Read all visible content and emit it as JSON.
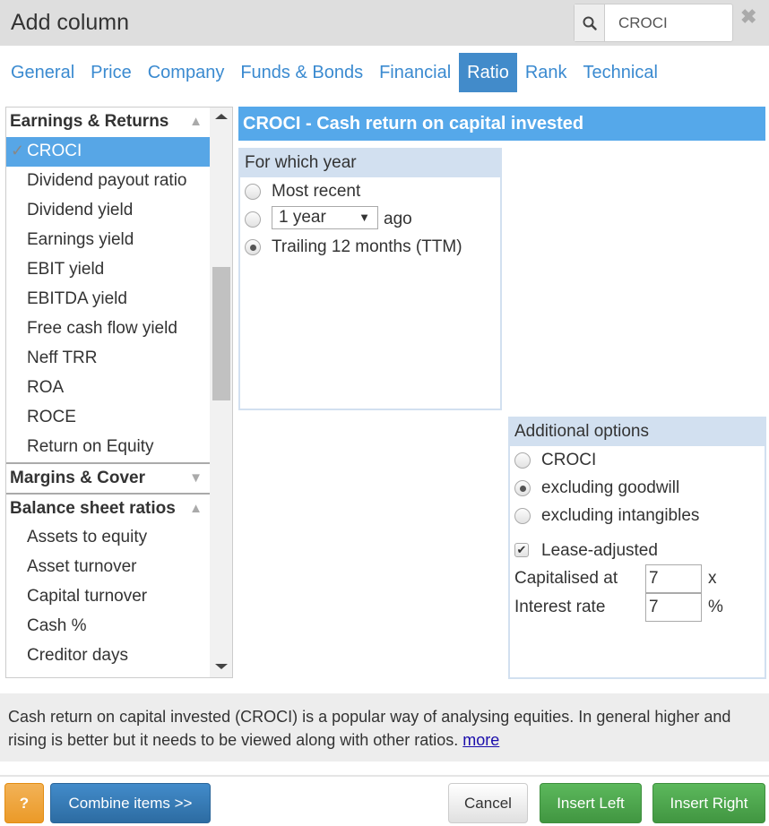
{
  "header": {
    "title": "Add column",
    "search_value": "CROCI",
    "search_icon": "search-icon",
    "close_icon": "close-icon",
    "close_glyph": "✖"
  },
  "tabs": [
    {
      "label": "General",
      "active": false
    },
    {
      "label": "Price",
      "active": false
    },
    {
      "label": "Company",
      "active": false
    },
    {
      "label": "Funds & Bonds",
      "active": false
    },
    {
      "label": "Financial",
      "active": false
    },
    {
      "label": "Ratio",
      "active": true
    },
    {
      "label": "Rank",
      "active": false
    },
    {
      "label": "Technical",
      "active": false
    }
  ],
  "list": {
    "groups": [
      {
        "label": "Earnings & Returns",
        "expanded": true,
        "arrow": "▲",
        "items": [
          {
            "label": "CROCI",
            "selected": true
          },
          {
            "label": "Dividend payout ratio",
            "selected": false
          },
          {
            "label": "Dividend yield",
            "selected": false
          },
          {
            "label": "Earnings yield",
            "selected": false
          },
          {
            "label": "EBIT yield",
            "selected": false
          },
          {
            "label": "EBITDA yield",
            "selected": false
          },
          {
            "label": "Free cash flow yield",
            "selected": false
          },
          {
            "label": "Neff TRR",
            "selected": false
          },
          {
            "label": "ROA",
            "selected": false
          },
          {
            "label": "ROCE",
            "selected": false
          },
          {
            "label": "Return on Equity",
            "selected": false
          }
        ]
      },
      {
        "label": "Margins & Cover",
        "expanded": false,
        "arrow": "▼",
        "items": []
      },
      {
        "label": "Balance sheet ratios",
        "expanded": true,
        "arrow": "▲",
        "items": [
          {
            "label": "Assets to equity",
            "selected": false
          },
          {
            "label": "Asset turnover",
            "selected": false
          },
          {
            "label": "Capital turnover",
            "selected": false
          },
          {
            "label": "Cash %",
            "selected": false
          },
          {
            "label": "Creditor days",
            "selected": false
          }
        ]
      }
    ],
    "check_glyph": "✓"
  },
  "detail": {
    "title": "CROCI - Cash return on capital invested",
    "year_panel": {
      "heading": "For which year",
      "options": [
        {
          "label": "Most recent",
          "checked": false
        },
        {
          "label": "ago",
          "checked": false,
          "select_value": "1 year"
        },
        {
          "label": "Trailing 12 months (TTM)",
          "checked": true
        }
      ]
    },
    "options_panel": {
      "heading": "Additional options",
      "radios": [
        {
          "label": "CROCI",
          "checked": false
        },
        {
          "label": "excluding goodwill",
          "checked": true
        },
        {
          "label": "excluding intangibles",
          "checked": false
        }
      ],
      "lease_adjusted": {
        "label": "Lease-adjusted",
        "checked": true
      },
      "capitalised": {
        "label": "Capitalised at",
        "value": "7",
        "unit": "x"
      },
      "interest": {
        "label": "Interest rate",
        "value": "7",
        "unit": "%"
      }
    }
  },
  "description": {
    "text": "Cash return on capital invested (CROCI) is a popular way of analysing equities. In general higher and rising is better but it needs to be viewed along with other ratios. ",
    "link": "more"
  },
  "buttons": {
    "help": "?",
    "combine": "Combine items >>",
    "cancel": "Cancel",
    "insert_left": "Insert Left",
    "insert_right": "Insert Right"
  }
}
